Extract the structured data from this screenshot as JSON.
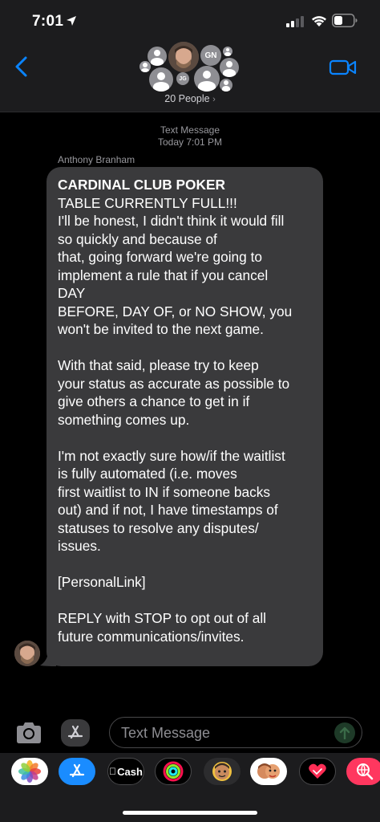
{
  "status_bar": {
    "time": "7:01"
  },
  "header": {
    "people_count": "20 People",
    "avatar_initials": [
      "GN",
      "JG"
    ]
  },
  "thread": {
    "service_label": "Text Message",
    "timestamp": "Today 7:01 PM",
    "sender_name": "Anthony Branham",
    "message": {
      "title": "CARDINAL CLUB POKER",
      "body": "TABLE CURRENTLY FULL!!!\nI'll be honest, I didn't think it would fill\nso quickly and because of\nthat, going forward we're going to\nimplement a rule that if you cancel\nDAY\nBEFORE, DAY OF, or NO SHOW, you\nwon't be invited to the next game.\n\nWith that said, please try to keep\nyour status as accurate as possible to\ngive others a chance to get in if\nsomething comes up.\n\nI'm not exactly sure how/if the waitlist\nis fully automated (i.e. moves\nfirst waitlist to IN if someone backs\nout) and if not, I have timestamps of\nstatuses to resolve any disputes/\nissues.\n\n[PersonalLink]\n\nREPLY with STOP to opt out of all\nfuture communications/invites."
    }
  },
  "composer": {
    "placeholder": "Text Message"
  },
  "app_drawer": {
    "items": [
      {
        "name": "photos-app",
        "icon": "photos-icon"
      },
      {
        "name": "app-store-app",
        "icon": "app-store-icon"
      },
      {
        "name": "apple-cash-app",
        "icon": "apple-cash-icon",
        "label": "Cash"
      },
      {
        "name": "activity-app",
        "icon": "activity-rings-icon"
      },
      {
        "name": "memoji-app",
        "icon": "memoji-icon"
      },
      {
        "name": "memoji-stickers-app",
        "icon": "memoji-stickers-icon"
      },
      {
        "name": "digital-touch-app",
        "icon": "heart-icon"
      },
      {
        "name": "images-search-app",
        "icon": "globe-search-icon"
      }
    ]
  },
  "colors": {
    "accent_blue": "#0a84ff",
    "bubble_gray": "#3a3a3c",
    "background": "#000000",
    "bar_background": "#1c1c1e"
  }
}
